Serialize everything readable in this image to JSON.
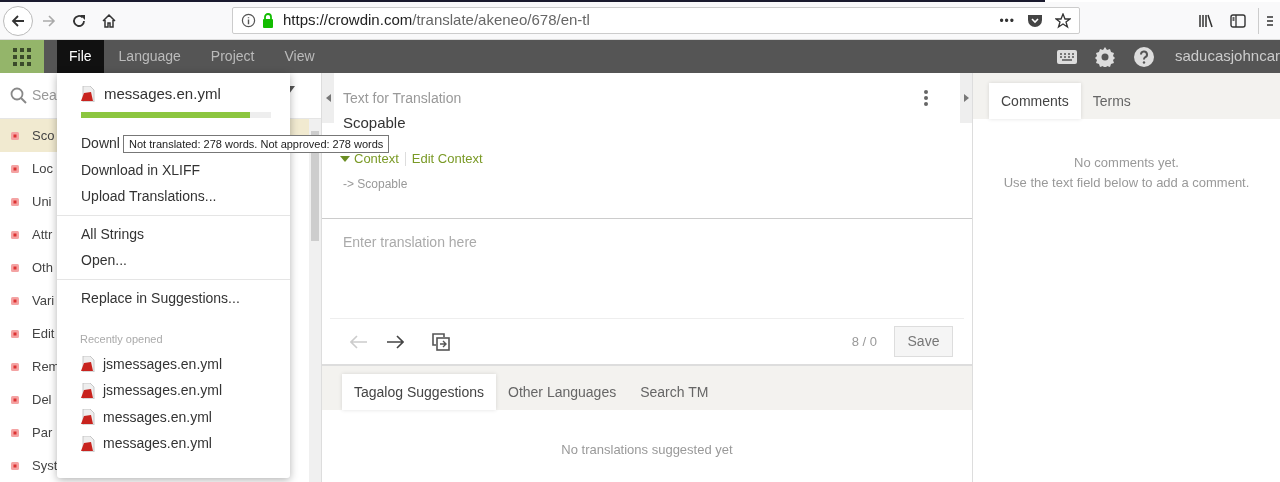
{
  "browser": {
    "url_domain": "https://crowdin.com",
    "url_path": "/translate/akeneo/678/en-tl",
    "more": "•••"
  },
  "nav": {
    "menus": [
      {
        "label": "File",
        "selected": true
      },
      {
        "label": "Language",
        "selected": false
      },
      {
        "label": "Project",
        "selected": false
      },
      {
        "label": "View",
        "selected": false
      }
    ],
    "user": "saducasjohncar"
  },
  "sidebar": {
    "search_placeholder": "Sea",
    "items": [
      {
        "label": "Sco",
        "selected": true
      },
      {
        "label": "Loc",
        "selected": false
      },
      {
        "label": "Uni",
        "selected": false
      },
      {
        "label": "Attr",
        "selected": false
      },
      {
        "label": "Oth",
        "selected": false
      },
      {
        "label": "Vari",
        "selected": false
      },
      {
        "label": "Edit",
        "selected": false
      },
      {
        "label": "Rem",
        "selected": false
      },
      {
        "label": "Del",
        "selected": false
      },
      {
        "label": "Par",
        "selected": false
      },
      {
        "label": "Syst",
        "selected": false
      }
    ]
  },
  "file_menu": {
    "current_file": "messages.en.yml",
    "level": 0.89,
    "groups": [
      [
        "Downl",
        "Download in XLIFF",
        "Upload Translations..."
      ],
      [
        "All Strings",
        "Open..."
      ],
      [
        "Replace in Suggestions..."
      ]
    ],
    "recent_heading": "Recently opened",
    "recent_files": [
      "jsmessages.en.yml",
      "jsmessages.en.yml",
      "messages.en.yml",
      "messages.en.yml"
    ],
    "tooltip": "Not translated: 278 words. Not approved: 278 words"
  },
  "editor": {
    "heading": "Text for Translation",
    "source": "Scopable",
    "context_label": "Context",
    "edit_context": "Edit Context",
    "context_text": "-> Scopable",
    "translation_placeholder": "Enter translation here",
    "counter": "8 / 0",
    "save": "Save",
    "tabs": [
      {
        "label": "Tagalog Suggestions",
        "selected": true
      },
      {
        "label": "Other Languages",
        "selected": false
      },
      {
        "label": "Search TM",
        "selected": false
      }
    ],
    "empty_message": "No translations suggested yet"
  },
  "side_panel": {
    "tabs": [
      {
        "label": "Comments",
        "selected": true
      },
      {
        "label": "Terms",
        "selected": false
      }
    ],
    "empty_message": "No comments yet.",
    "hint": "Use the text field below to add a comment."
  }
}
